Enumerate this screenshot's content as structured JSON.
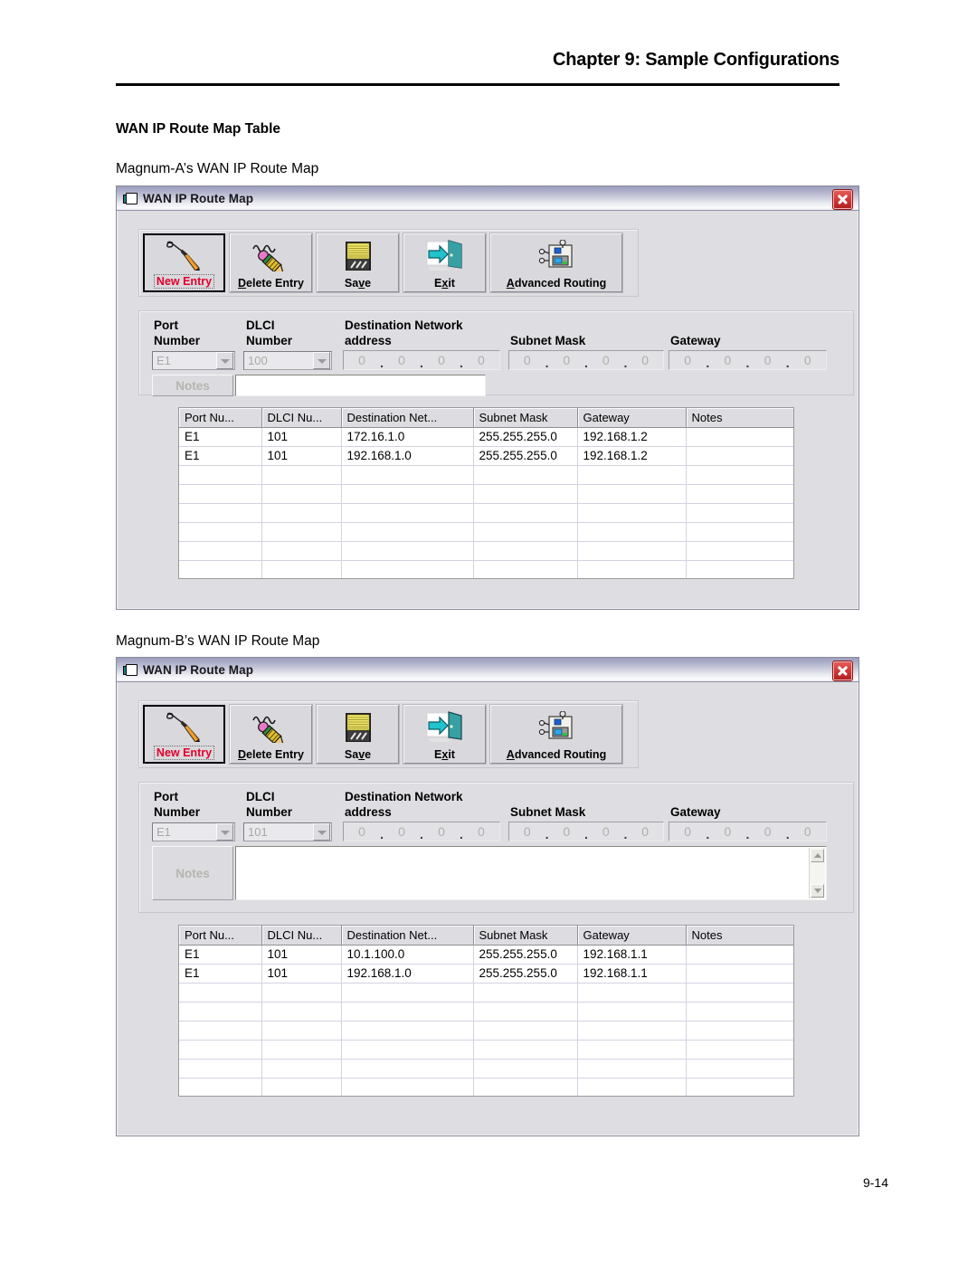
{
  "page": {
    "chapter_title": "Chapter 9: Sample Configurations",
    "section_title": "WAN IP Route Map Table",
    "caption_a": "Magnum-A’s WAN IP Route Map",
    "caption_b": "Magnum-B’s WAN IP Route Map",
    "page_number": "9-14"
  },
  "window": {
    "title": "WAN IP Route Map",
    "close_label": "X",
    "toolbar": [
      {
        "label": "New Entry",
        "icon": "pen-new-entry-icon",
        "accent_color": "#e2002a",
        "focused": true
      },
      {
        "label": "Delete Entry",
        "icon": "eraser-delete-icon",
        "accent_color": "#000000",
        "focused": false
      },
      {
        "label": "Save",
        "icon": "floppy-disk-save-icon",
        "accent_color": "#000000",
        "focused": false
      },
      {
        "label": "Exit",
        "icon": "door-exit-icon",
        "accent_color": "#000000",
        "focused": false
      },
      {
        "label": "Advanced Routing",
        "icon": "network-router-icon",
        "accent_color": "#000000",
        "focused": false
      }
    ],
    "form_labels": {
      "port_number_l1": "Port",
      "port_number_l2": "Number",
      "dlci_number_l1": "DLCI",
      "dlci_number_l2": "Number",
      "destination_l1": "Destination Network",
      "destination_l2": "address",
      "subnet_mask": "Subnet Mask",
      "gateway": "Gateway",
      "notes": "Notes"
    },
    "ip_octet": "0",
    "ip_separator": ".",
    "grid_headers": [
      "Port Nu...",
      "DLCI Nu...",
      "Destination Net...",
      "Subnet Mask",
      "Gateway",
      "Notes"
    ],
    "empty_rows": 8
  },
  "window_a": {
    "port_number_value": "E1",
    "dlci_number_value": "100",
    "notes_value": "",
    "rows": [
      {
        "port": "E1",
        "dlci": "101",
        "destination": "172.16.1.0",
        "subnet": "255.255.255.0",
        "gateway": "192.168.1.2",
        "notes": ""
      },
      {
        "port": "E1",
        "dlci": "101",
        "destination": "192.168.1.0",
        "subnet": "255.255.255.0",
        "gateway": "192.168.1.2",
        "notes": ""
      }
    ]
  },
  "window_b": {
    "port_number_value": "E1",
    "dlci_number_value": "101",
    "notes_value": "",
    "rows": [
      {
        "port": "E1",
        "dlci": "101",
        "destination": "10.1.100.0",
        "subnet": "255.255.255.0",
        "gateway": "192.168.1.1",
        "notes": ""
      },
      {
        "port": "E1",
        "dlci": "101",
        "destination": "192.168.1.0",
        "subnet": "255.255.255.0",
        "gateway": "192.168.1.1",
        "notes": ""
      }
    ]
  },
  "colors": {
    "window_face": "#dedde1",
    "titlebar_top": "#9c9fbe",
    "titlebar_bottom": "#fbfbfd",
    "close_red": "#c8302e",
    "new_entry_red": "#e2002a",
    "grid_header": "#dddde1"
  }
}
